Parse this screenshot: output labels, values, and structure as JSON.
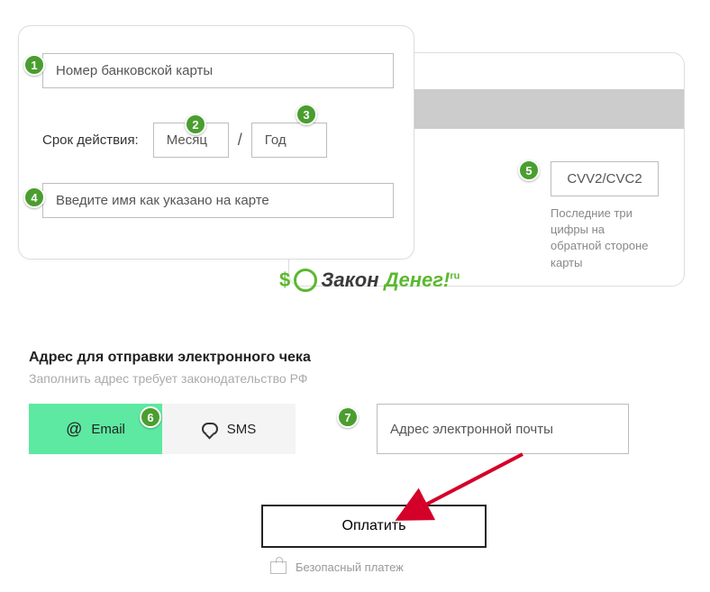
{
  "badges": {
    "b1": "1",
    "b2": "2",
    "b3": "3",
    "b4": "4",
    "b5": "5",
    "b6": "6",
    "b7": "7"
  },
  "card": {
    "number_placeholder": "Номер банковской карты",
    "expiry_label": "Срок действия:",
    "month_placeholder": "Месяц",
    "year_placeholder": "Год",
    "name_placeholder": "Введите имя как указано на карте",
    "cvv_placeholder": "CVV2/CVC2",
    "cvv_hint": "Последние три цифры на обратной стороне карты"
  },
  "logo": {
    "part1": "Закон",
    "part2": " Денег!",
    "ru": "ru"
  },
  "receipt": {
    "title": "Адрес для отправки электронного чека",
    "subtitle": "Заполнить адрес требует законодательство РФ",
    "email_label": "Email",
    "sms_label": "SMS",
    "email_placeholder": "Адрес электронной почты"
  },
  "actions": {
    "pay_label": "Оплатить",
    "secure_label": "Безопасный платеж"
  }
}
